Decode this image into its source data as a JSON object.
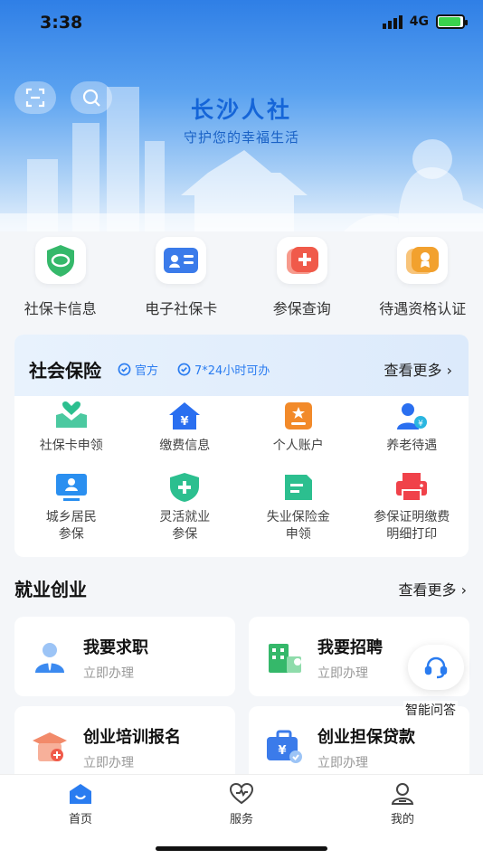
{
  "status": {
    "time": "3:38",
    "network": "4G"
  },
  "hero": {
    "title": "长沙人社",
    "subtitle": "守护您的幸福生活",
    "scan_icon": "scan-icon",
    "search_icon": "search-icon"
  },
  "quick": [
    {
      "label": "社保卡信息",
      "icon": "social-card-shield-icon",
      "color": "#35b86a"
    },
    {
      "label": "电子社保卡",
      "icon": "id-card-icon",
      "color": "#3b7bea"
    },
    {
      "label": "参保查询",
      "icon": "medical-plus-icon",
      "color": "#f05a4a"
    },
    {
      "label": "待遇资格认证",
      "icon": "badge-certification-icon",
      "color": "#f2a12e"
    }
  ],
  "insurance": {
    "title": "社会保险",
    "tag_official": "官方",
    "tag_hours": "7*24小时可办",
    "more": "查看更多",
    "items": [
      {
        "label": "社保卡申领",
        "icon": "hands-heart-icon",
        "color": "#2cbf8f"
      },
      {
        "label": "缴费信息",
        "icon": "yen-house-icon",
        "color": "#2a6ff0"
      },
      {
        "label": "个人账户",
        "icon": "account-star-icon",
        "color": "#f28a2a"
      },
      {
        "label": "养老待遇",
        "icon": "elderly-pension-icon",
        "color": "#2a6ff0"
      },
      {
        "label": "城乡居民\n参保",
        "icon": "monitor-person-icon",
        "color": "#2a8ff0"
      },
      {
        "label": "灵活就业\n参保",
        "icon": "shield-plus-icon",
        "color": "#2cbf8f"
      },
      {
        "label": "失业保险金\n申领",
        "icon": "document-icon",
        "color": "#2cbf8f"
      },
      {
        "label": "参保证明缴费\n明细打印",
        "icon": "printer-icon",
        "color": "#f0424a"
      }
    ]
  },
  "employment": {
    "title": "就业创业",
    "more": "查看更多",
    "items": [
      {
        "title": "我要求职",
        "subtitle": "立即办理",
        "icon": "job-seeker-icon"
      },
      {
        "title": "我要招聘",
        "subtitle": "立即办理",
        "icon": "building-recruit-icon"
      },
      {
        "title": "创业培训报名",
        "subtitle": "立即办理",
        "icon": "graduation-cap-icon"
      },
      {
        "title": "创业担保贷款",
        "subtitle": "立即办理",
        "icon": "briefcase-loan-icon"
      }
    ]
  },
  "assistant": {
    "label": "智能问答",
    "icon": "headset-icon"
  },
  "tabs": [
    {
      "label": "首页",
      "icon": "home-icon",
      "active": true
    },
    {
      "label": "服务",
      "icon": "heart-service-icon",
      "active": false
    },
    {
      "label": "我的",
      "icon": "profile-icon",
      "active": false
    }
  ]
}
